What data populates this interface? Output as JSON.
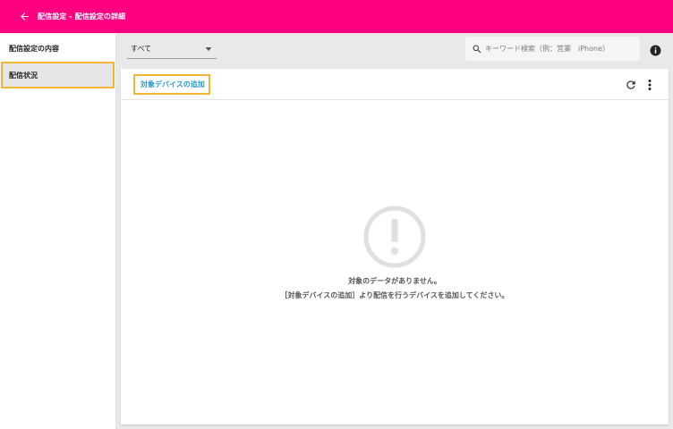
{
  "header": {
    "title": "配信設定 - 配信設定の詳細",
    "back_icon": "arrow-left-icon",
    "background_color": "#ff0080"
  },
  "sidebar": {
    "items": [
      {
        "label": "配信設定の内容",
        "active": false
      },
      {
        "label": "配信状況",
        "active": true
      }
    ]
  },
  "toolbar": {
    "filter": {
      "value": "すべて"
    },
    "search": {
      "placeholder": "キーワード検索（例：営業　iPhone）",
      "value": ""
    }
  },
  "card": {
    "add_device_label": "対象デバイスの追加",
    "empty": {
      "line1": "対象のデータがありません。",
      "line2": "［対象デバイスの追加］より配信を行うデバイスを追加してください。"
    }
  },
  "colors": {
    "accent": "#ff0080",
    "highlight": "#f5b534",
    "link": "#1e9bd7"
  }
}
